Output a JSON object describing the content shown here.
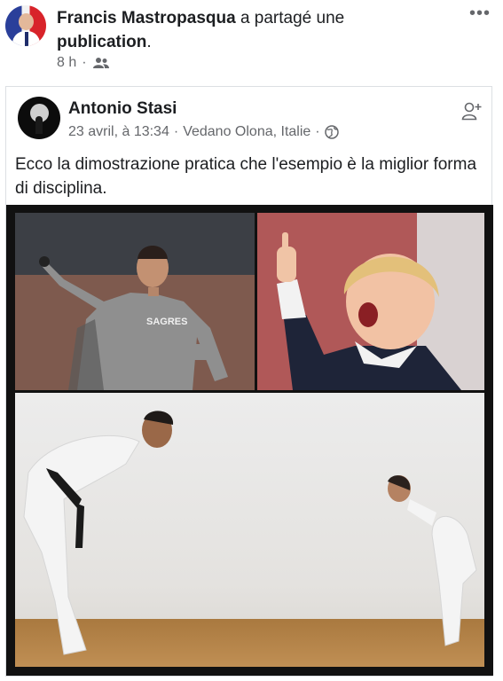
{
  "sharer": {
    "name": "Francis Mastropasqua",
    "action": "a partagé une",
    "object": "publication",
    "period": ".",
    "time": "8 h",
    "separator": "·",
    "audience_icon": "friends-icon",
    "more_label": "•••"
  },
  "post": {
    "author": "Antonio Stasi",
    "date": "23 avril, à 13:34",
    "separator1": "·",
    "location": "Vedano Olona, Italie",
    "separator2": "·",
    "privacy_icon": "globe-icon",
    "add_friend_icon": "add-friend-icon",
    "text": "Ecco la dimostrazione pratica che l'esempio è la miglior forma di disciplina."
  },
  "image": {
    "jersey_text": "SAGRES"
  },
  "colors": {
    "text": "#1c1e21",
    "meta": "#65676b",
    "border": "#dcdfe3"
  }
}
